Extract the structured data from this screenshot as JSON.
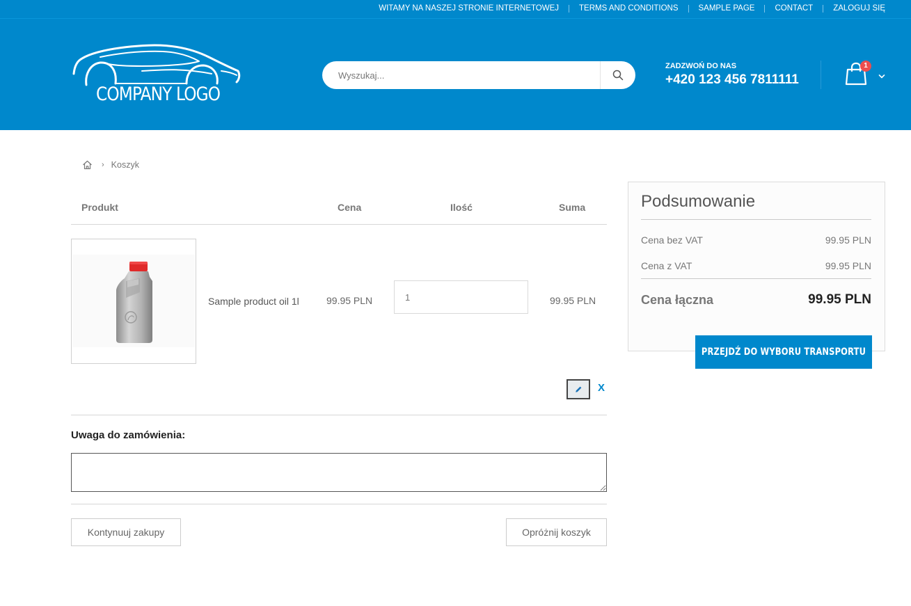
{
  "colors": {
    "brand": "#0088cc",
    "badge": "#ec4e4e"
  },
  "topbar": {
    "links": [
      "WITAMY NA NASZEJ STRONIE INTERNETOWEJ",
      "TERMS AND CONDITIONS",
      "SAMPLE PAGE",
      "CONTACT",
      "ZALOGUJ SIĘ"
    ]
  },
  "logo": {
    "text": "COMPANY LOGO",
    "icon": "car-silhouette-logo"
  },
  "search": {
    "placeholder": "Wyszukaj...",
    "icon": "search-icon"
  },
  "call": {
    "label": "ZADZWOŃ DO NAS",
    "number": "+420 123 456 7811111"
  },
  "cart": {
    "count": "1",
    "icon": "shopping-bag-icon"
  },
  "breadcrumb": {
    "home_icon": "home-icon",
    "current": "Koszyk"
  },
  "table": {
    "headers": {
      "product": "Produkt",
      "price": "Cena",
      "qty": "Ilość",
      "sum": "Suma"
    },
    "rows": [
      {
        "name": "Sample product oil 1l",
        "price": "99.95 PLN",
        "qty": "1",
        "sum": "99.95 PLN",
        "image": "oil-bottle-image"
      }
    ],
    "remove_label": "X"
  },
  "note": {
    "label": "Uwaga do zamówienia:",
    "value": ""
  },
  "buttons": {
    "continue": "Kontynuuj zakupy",
    "empty": "Opróżnij koszyk"
  },
  "summary": {
    "title": "Podsumowanie",
    "net_label": "Cena bez VAT",
    "net_value": "99.95 PLN",
    "gross_label": "Cena z VAT",
    "gross_value": "99.95 PLN",
    "total_label": "Cena łączna",
    "total_value": "99.95 PLN",
    "checkout": "PRZEJDŹ DO WYBORU TRANSPORTU"
  }
}
